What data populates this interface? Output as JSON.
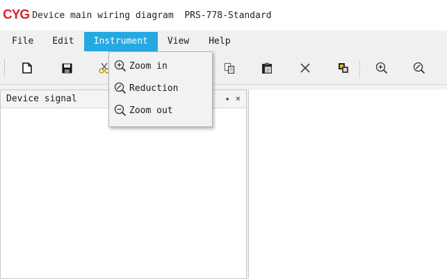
{
  "window": {
    "logo": "CYG",
    "title": "Device main wiring diagram  PRS-778-Standard"
  },
  "menubar": {
    "items": [
      {
        "label": "File"
      },
      {
        "label": "Edit"
      },
      {
        "label": "Instrument",
        "active": true
      },
      {
        "label": "View"
      },
      {
        "label": "Help"
      }
    ]
  },
  "toolbar": {
    "buttons": [
      "new-file-icon",
      "save-icon",
      "cut-icon",
      "copy-icon",
      "paste-icon",
      "delete-icon",
      "group-icon",
      "zoom-in-icon",
      "reduction-icon"
    ]
  },
  "left_panel": {
    "title": "Device signal",
    "pin": "✦",
    "close": "×"
  },
  "dropdown": {
    "items": [
      {
        "label": "Zoom in",
        "icon": "zoom-in-icon"
      },
      {
        "label": "Reduction",
        "icon": "reduction-icon"
      },
      {
        "label": "Zoom out",
        "icon": "zoom-out-icon"
      }
    ]
  },
  "colors": {
    "accent": "#26a8e1",
    "logo": "#d9262c"
  }
}
